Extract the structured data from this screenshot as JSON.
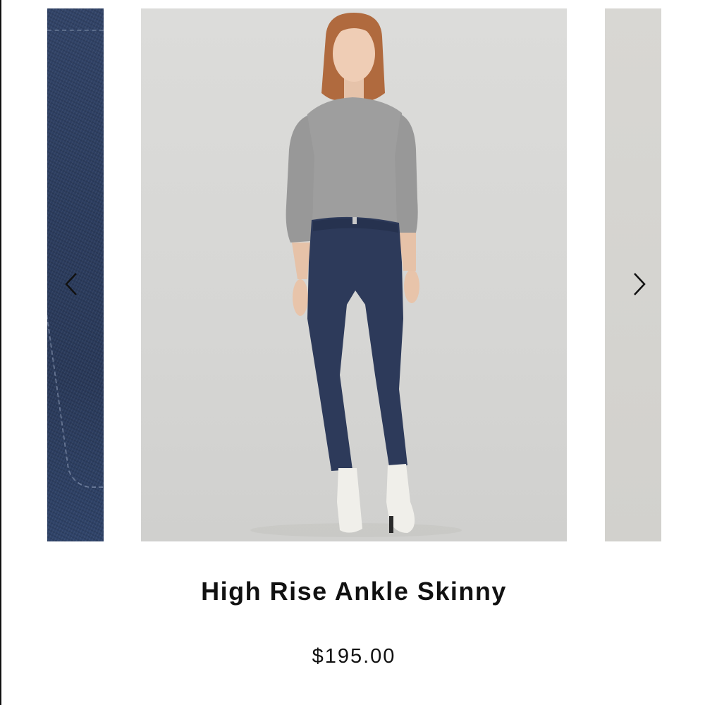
{
  "carousel": {
    "prev_slide_icon": "chevron-left-icon",
    "next_slide_icon": "chevron-right-icon",
    "slides": [
      {
        "subject": "denim-detail"
      },
      {
        "subject": "model-front"
      },
      {
        "subject": "model-side"
      }
    ]
  },
  "product": {
    "title": "High Rise Ankle Skinny",
    "price": "$195.00"
  },
  "colors": {
    "text": "#111111",
    "denim": "#2f3f62",
    "background": "#ffffff",
    "photo_backdrop": "#d8d8d6"
  }
}
